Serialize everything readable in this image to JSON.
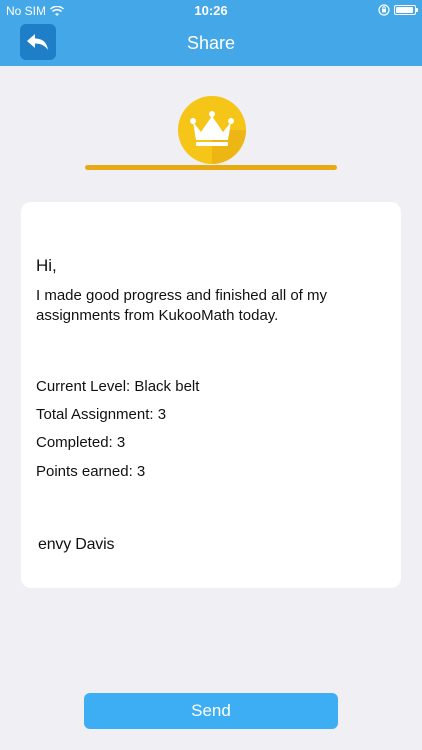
{
  "status_bar": {
    "carrier": "No SIM",
    "time": "10:26"
  },
  "nav": {
    "title": "Share",
    "back_icon": "back-arrow-icon"
  },
  "header": {
    "icon": "crown-icon",
    "accent_color": "#e8a913"
  },
  "message": {
    "greeting": "Hi,",
    "body": "I made good progress and finished all of my assignments from KukooMath today.",
    "stats": [
      "Current Level: Black belt",
      "Total Assignment: 3",
      "Completed: 3",
      "Points earned: 3"
    ],
    "signature": "envy Davis"
  },
  "actions": {
    "send_label": "Send"
  },
  "colors": {
    "primary": "#44a7e8",
    "button": "#3eaef4",
    "background": "#efeff4"
  }
}
